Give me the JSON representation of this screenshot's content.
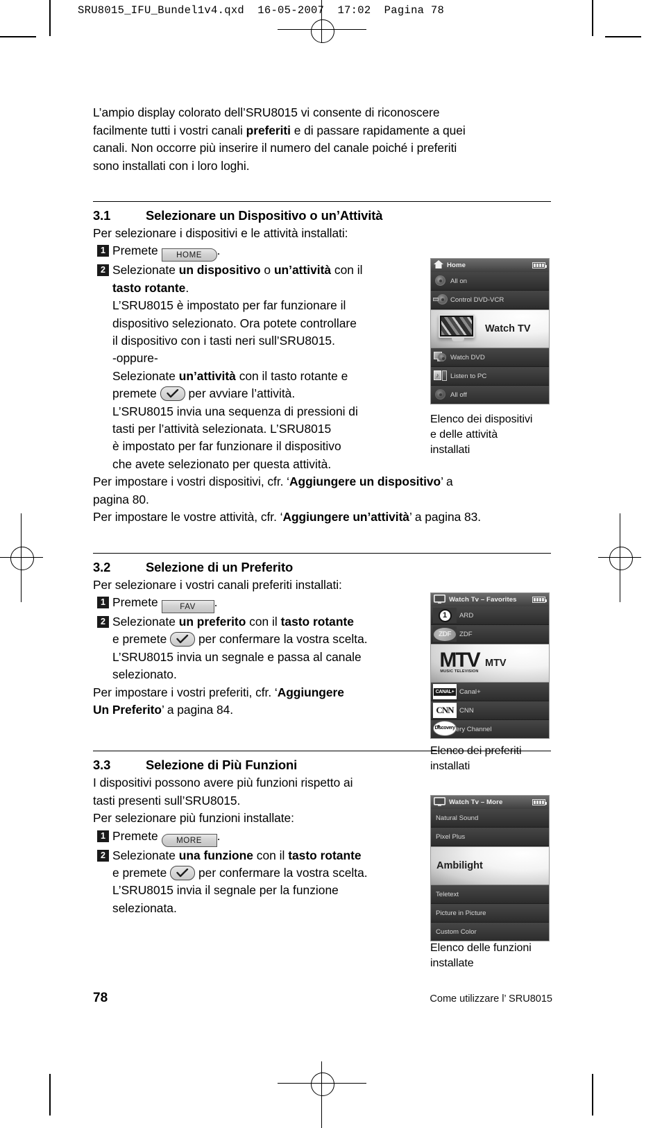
{
  "prepress": {
    "header": "SRU8015_IFU_Bundel1v4.qxd  16-05-2007  17:02  Pagina 78"
  },
  "intro": {
    "line1": "L’ampio display colorato dell’SRU8015 vi consente di riconoscere",
    "line2a": "facilmente tutti i vostri canali ",
    "line2b": "preferiti",
    "line2c": " e di passare rapidamente a quei",
    "line3": "canali. Non occorre più inserire il numero del canale poiché i preferiti",
    "line4": "sono installati con i loro loghi."
  },
  "sections": [
    {
      "number": "3.1",
      "title": "Selezionare un Dispositivo o un’Attività",
      "lead": "Per selezionare i dispositivi e le attività installati:",
      "step1_num": "1",
      "step1_pre": "Premete",
      "step1_key": "HOME",
      "step1_post": ".",
      "step2_num": "2",
      "step2_a": "Selezionate ",
      "step2_b": "un dispositivo",
      "step2_c": " o ",
      "step2_d": "un’attività",
      "step2_e": " con il",
      "step2_f": "tasto rotante",
      "step2_g": ".",
      "para1_l1": "L’SRU8015 è impostato per far funzionare il",
      "para1_l2": "dispositivo selezionato. Ora potete controllare",
      "para1_l3": "il dispositivo con i tasti neri sull’SRU8015.",
      "oppure": "-oppure-",
      "para2_a": "Selezionate ",
      "para2_b": "un’attività",
      "para2_c": " con il tasto rotante e",
      "para2_d": "premete",
      "para2_e": "per avviare l’attività.",
      "para3_l1": "L’SRU8015 invia una sequenza di pressioni di",
      "para3_l2": "tasti per l’attività selezionata. L’SRU8015",
      "para3_l3": "è impostato per far funzionare il dispositivo",
      "para3_l4": "che avete selezionato per questa attività.",
      "outro1_a": "Per impostare i vostri dispositivi, cfr. ‘",
      "outro1_b": "Aggiungere un dispositivo",
      "outro1_c": "’ a",
      "outro1_d": "pagina 80.",
      "outro2_a": "Per impostare le vostre attività, cfr. ‘",
      "outro2_b": "Aggiungere un’attività",
      "outro2_c": "’ a pagina 83."
    },
    {
      "number": "3.2",
      "title": "Selezione di un Preferito",
      "lead": "Per selezionare i vostri canali preferiti installati:",
      "step1_num": "1",
      "step1_pre": "Premete",
      "step1_key": "FAV",
      "step1_post": ".",
      "step2_num": "2",
      "step2_a": "Selezionate ",
      "step2_b": "un preferito",
      "step2_c": " con il ",
      "step2_d": "tasto rotante",
      "step2_e": "e premete",
      "step2_f": "per confermare la vostra scelta.",
      "para_l1": "L’SRU8015 invia un segnale e passa al canale",
      "para_l2": "selezionato.",
      "outro_a": "Per impostare i vostri preferiti, cfr. ‘",
      "outro_b": "Aggiungere",
      "outro_c": "Un Preferito",
      "outro_d": "’ a pagina 84."
    },
    {
      "number": "3.3",
      "title": "Selezione di Più Funzioni",
      "lead_l1": "I dispositivi possono avere più funzioni rispetto ai",
      "lead_l2": "tasti presenti sull’SRU8015.",
      "lead_l3": "Per selezionare più funzioni installate:",
      "step1_num": "1",
      "step1_pre": "Premete",
      "step1_key": "MORE",
      "step1_post": ".",
      "step2_num": "2",
      "step2_a": "Selezionate ",
      "step2_b": "una funzione",
      "step2_c": " con il ",
      "step2_d": "tasto rotante",
      "step2_e": "e premete",
      "step2_f": "per confermare la vostra scelta.",
      "para_l1": "L’SRU8015 invia il segnale per la funzione",
      "para_l2": "selezionata."
    }
  ],
  "screenshots": {
    "devices": {
      "title": "Home",
      "title_icon": "home-icon",
      "battery_icon": "battery-full-icon",
      "rows": [
        {
          "label": "All on",
          "icon": "disc-icon",
          "selected": false
        },
        {
          "label": "Control DVD-VCR",
          "icon": "dvd-vcr-icon",
          "selected": false
        },
        {
          "label": "Watch TV",
          "icon": "tv-icon",
          "selected": true
        },
        {
          "label": "Watch DVD",
          "icon": "dvd-icon",
          "selected": false
        },
        {
          "label": "Listen to PC",
          "icon": "pc-music-icon",
          "selected": false
        },
        {
          "label": "All off",
          "icon": "disc-icon",
          "selected": false
        }
      ],
      "caption_l1": "Elenco dei dispositivi",
      "caption_l2": "e delle attività",
      "caption_l3": "installati"
    },
    "favorites": {
      "title": "Watch Tv – Favorites",
      "title_icon": "tv-icon",
      "battery_icon": "battery-full-icon",
      "rows": [
        {
          "label": "ARD",
          "logo": "ard-logo",
          "logo_text": "1",
          "selected": false
        },
        {
          "label": "ZDF",
          "logo": "zdf-logo",
          "logo_text": "ZDF",
          "selected": false
        },
        {
          "label": "MTV",
          "logo": "mtv-logo",
          "logo_text": "MTV",
          "logo_sub": "MUSIC TELEVISION",
          "selected": true
        },
        {
          "label": "Canal+",
          "logo": "canalplus-logo",
          "logo_text": "CANAL+",
          "selected": false
        },
        {
          "label": "CNN",
          "logo": "cnn-logo",
          "logo_text": "CNN",
          "selected": false
        },
        {
          "label": "Discovery Channel",
          "logo": "discovery-logo",
          "logo_text": "Discovery",
          "selected": false
        }
      ],
      "caption_l1": "Elenco dei preferiti",
      "caption_l2": "installati"
    },
    "functions": {
      "title": "Watch Tv – More",
      "title_icon": "tv-icon",
      "battery_icon": "battery-full-icon",
      "rows": [
        {
          "label": "Natural Sound",
          "selected": false
        },
        {
          "label": "Pixel Plus",
          "selected": false
        },
        {
          "label": "Ambilight",
          "selected": true
        },
        {
          "label": "Teletext",
          "selected": false
        },
        {
          "label": "Picture in Picture",
          "selected": false
        },
        {
          "label": "Custom Color",
          "selected": false
        }
      ],
      "caption_l1": "Elenco delle funzioni",
      "caption_l2": "installate"
    }
  },
  "footer": {
    "page_number": "78",
    "running_head": "Come utilizzare l’ SRU8015"
  }
}
